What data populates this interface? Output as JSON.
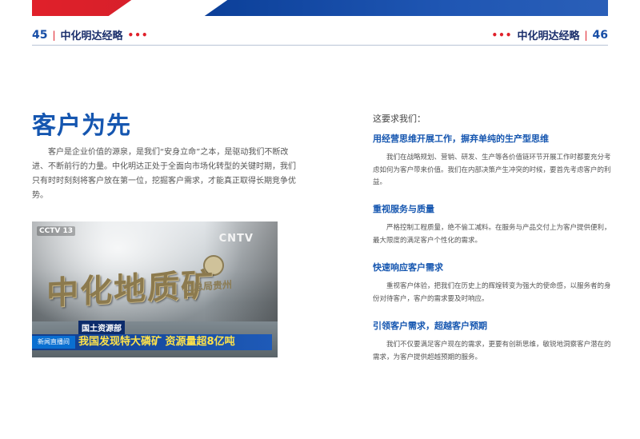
{
  "header": {
    "left": {
      "page_number": "45",
      "separator": "|",
      "title": "中化明达经略",
      "dots": "•••"
    },
    "right": {
      "page_number": "46",
      "separator": "|",
      "title": "中化明达经略",
      "dots": "•••"
    },
    "colors": {
      "red": "#e0202a",
      "blue": "#0b3f98"
    }
  },
  "left_page": {
    "heading": "客户为先",
    "intro": "客户是企业价值的源泉，是我们“安身立命”之本，是驱动我们不断改进、不断前行的力量。中化明达正处于全面向市场化转型的关键时期，我们只有时时刻刻将客户放在第一位，挖掘客户需求，才能真正取得长期竞争优势。",
    "photo": {
      "sign_text": "中化地质矿",
      "sign_small": "山总局贵州",
      "cctv_logo": "CCTV 13",
      "cctv_right": "CNTV",
      "dept_label": "国土资源部",
      "news_tag": "新闻直播间",
      "news_headline": "我国发现特大磷矿 资源量超8亿吨"
    }
  },
  "right_page": {
    "lead": "这要求我们：",
    "sections": [
      {
        "title": "用经营思维开展工作，摒弃单纯的生产型思维",
        "body": "我们在战略规划、营销、研发、生产等各价值链环节开展工作时都要充分考虑如何为客户带来价值。我们在内部决策产生冲突的时候，要首先考虑客户的利益。"
      },
      {
        "title": "重视服务与质量",
        "body": "严格控制工程质量，绝不偷工减料。在服务与产品交付上为客户提供便利，最大限度的满足客户个性化的需求。"
      },
      {
        "title": "快速响应客户需求",
        "body": "重视客户体验，把我们在历史上的辉煌转变为强大的使命感，以服务者的身份对待客户，客户的需求要及时响应。"
      },
      {
        "title": "引领客户需求，超越客户预期",
        "body": "我们不仅要满足客户现在的需求，更要有创新思维，敏锐地洞察客户潜在的需求，为客户提供超越预期的服务。"
      }
    ]
  }
}
